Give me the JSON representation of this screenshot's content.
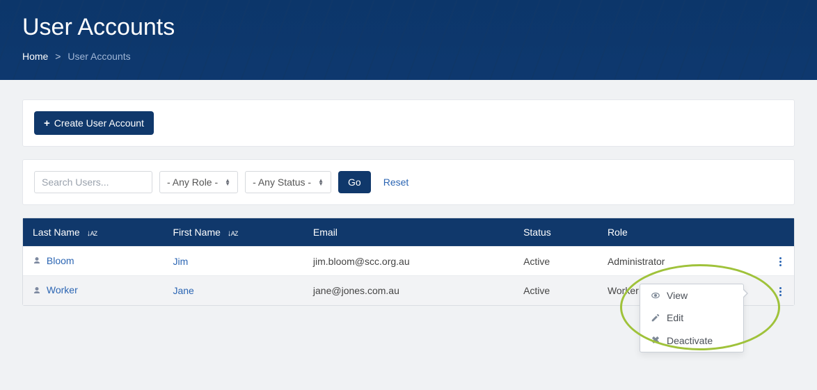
{
  "hero": {
    "title": "User Accounts"
  },
  "breadcrumb": {
    "home": "Home",
    "separator": ">",
    "current": "User Accounts"
  },
  "toolbar": {
    "create_label": "Create User Account"
  },
  "filters": {
    "search_placeholder": "Search Users...",
    "role_selected": "- Any Role -",
    "status_selected": "- Any Status -",
    "go_label": "Go",
    "reset_label": "Reset"
  },
  "table": {
    "headers": {
      "last_name": "Last Name",
      "first_name": "First Name",
      "email": "Email",
      "status": "Status",
      "role": "Role"
    },
    "rows": [
      {
        "last_name": "Bloom",
        "first_name": "Jim",
        "email": "jim.bloom@scc.org.au",
        "status": "Active",
        "role": "Administrator"
      },
      {
        "last_name": "Worker",
        "first_name": "Jane",
        "email": "jane@jones.com.au",
        "status": "Active",
        "role": "Worker"
      }
    ]
  },
  "row_menu": {
    "view": "View",
    "edit": "Edit",
    "deactivate": "Deactivate"
  }
}
